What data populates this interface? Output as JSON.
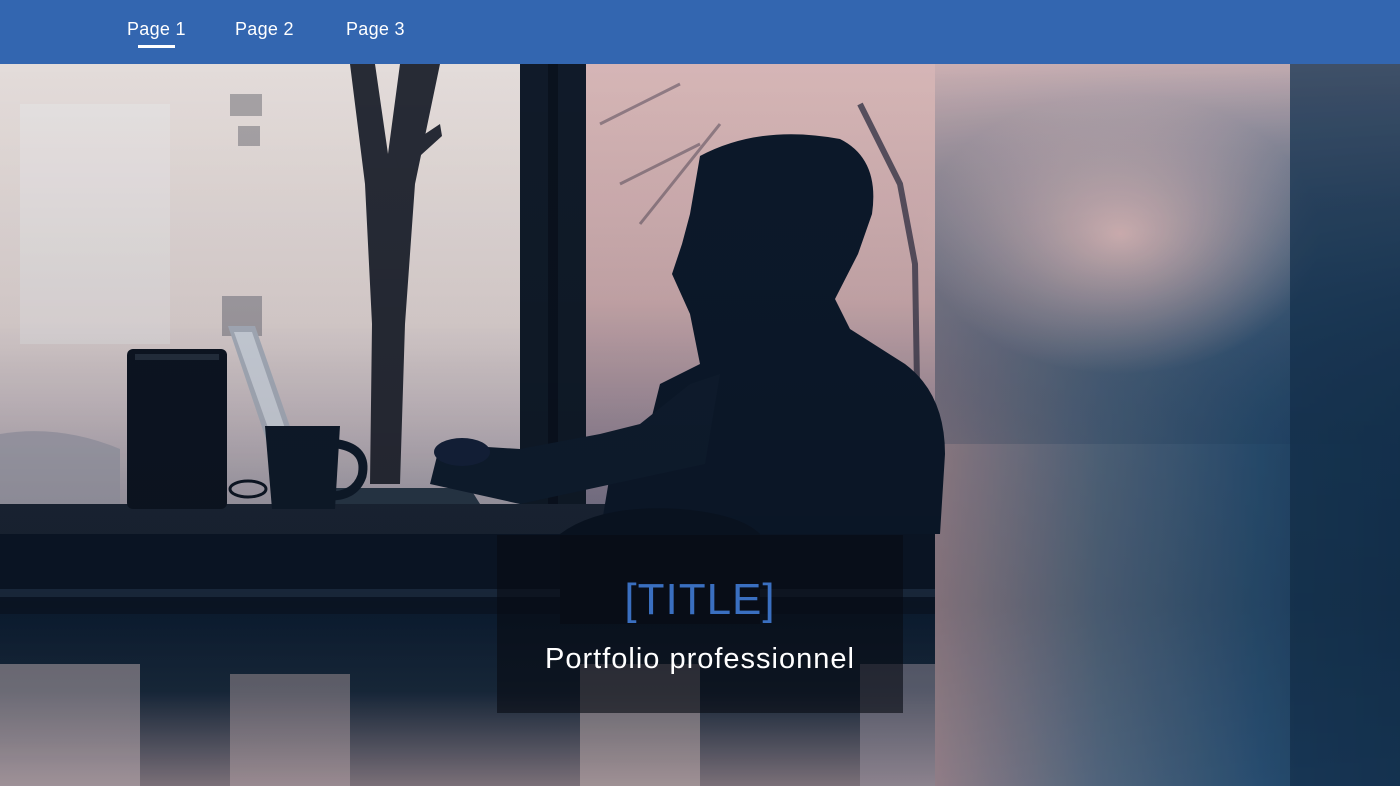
{
  "nav": {
    "items": [
      {
        "label": "Page 1",
        "active": true
      },
      {
        "label": "Page 2",
        "active": false
      },
      {
        "label": "Page 3",
        "active": false
      }
    ]
  },
  "hero": {
    "image_icon": "cafe-laptop-silhouette-photo",
    "title": "[TITLE]",
    "subtitle": "Portfolio professionnel"
  },
  "colors": {
    "nav_bg": "#3366b0",
    "title_accent": "#3a6fc0",
    "subtitle": "#ffffff"
  }
}
